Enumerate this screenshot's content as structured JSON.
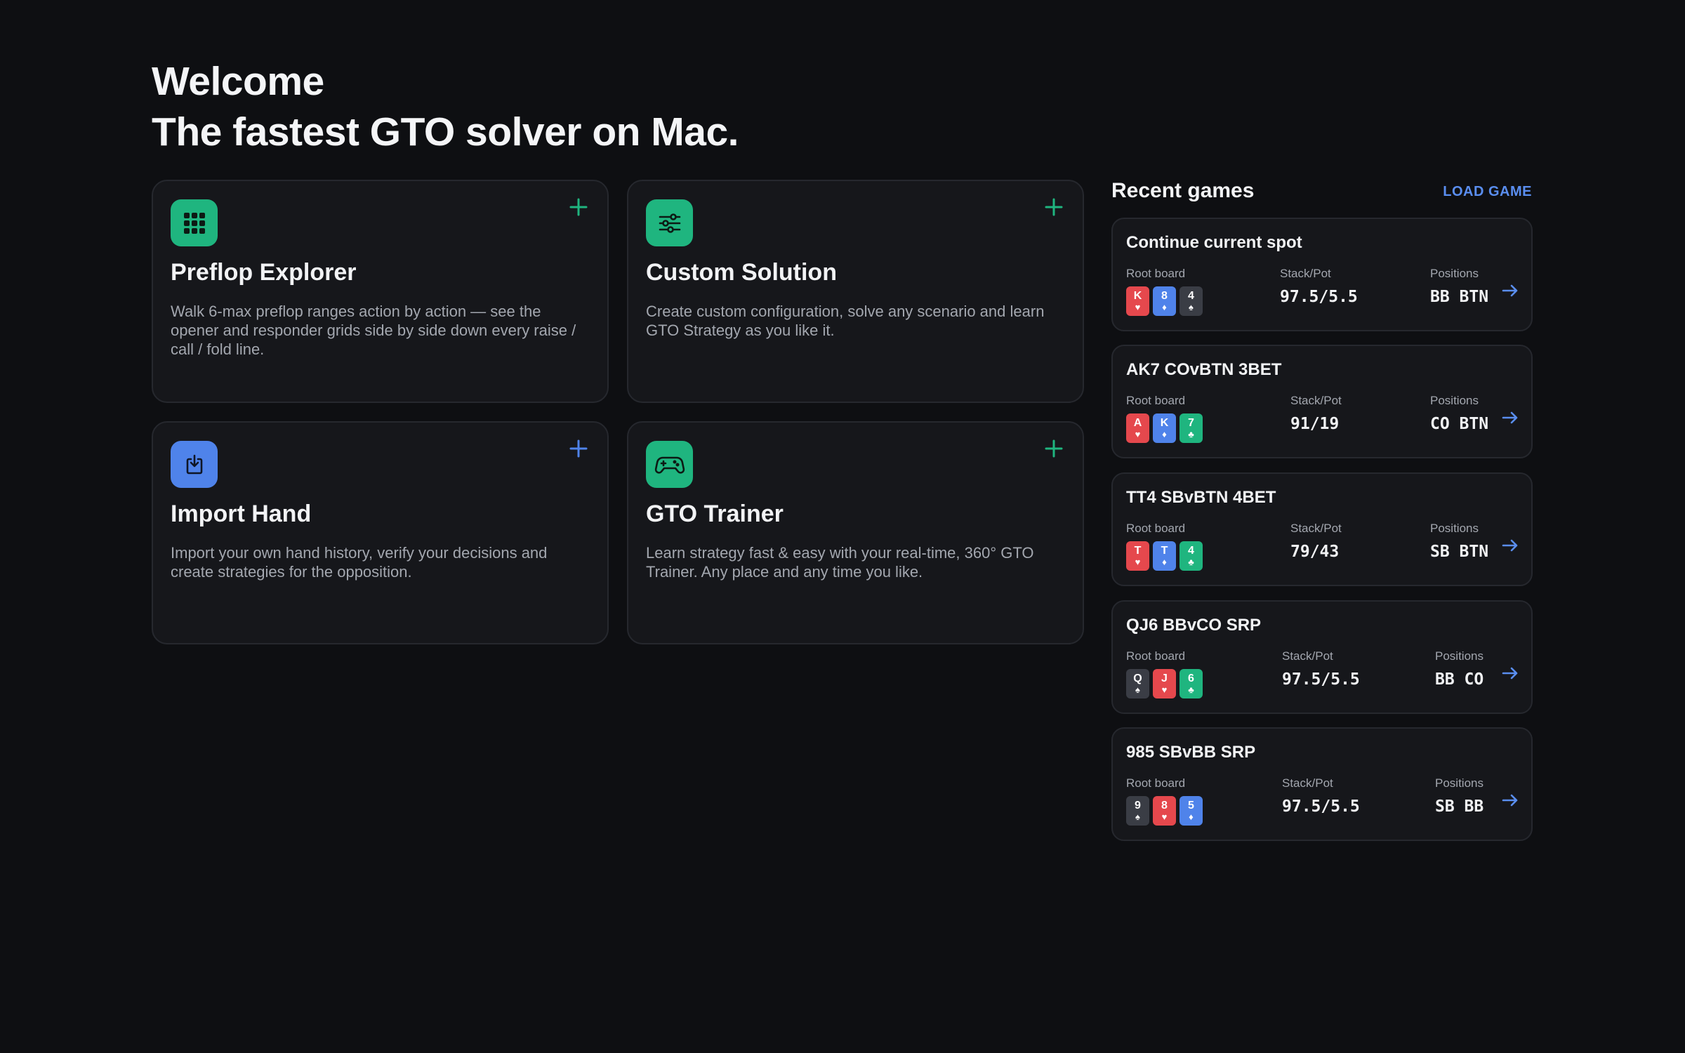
{
  "header": {
    "line1": "Welcome",
    "line2": "The fastest GTO solver on Mac."
  },
  "features": [
    {
      "title": "Preflop Explorer",
      "description": "Walk 6-max preflop ranges action by action — see the opener and responder grids side by side down every raise / call / fold line.",
      "icon": "grid-icon",
      "accent": "#1fb57f"
    },
    {
      "title": "Custom Solution",
      "description": "Create custom configuration, solve any scenario and learn GTO Strategy as you like it.",
      "icon": "sliders-icon",
      "accent": "#1fb57f"
    },
    {
      "title": "Import Hand",
      "description": "Import your own hand history, verify your decisions and create strategies for the opposition.",
      "icon": "import-icon",
      "accent": "#4f83ea"
    },
    {
      "title": "GTO Trainer",
      "description": "Learn strategy fast & easy with your real-time, 360° GTO Trainer. Any place and any time you like.",
      "icon": "gamepad-icon",
      "accent": "#1fb57f"
    }
  ],
  "recent": {
    "title": "Recent games",
    "load_label": "LOAD GAME",
    "labels": {
      "board": "Root board",
      "stack": "Stack/Pot",
      "positions": "Positions"
    },
    "games": [
      {
        "title": "Continue current spot",
        "board": [
          {
            "rank": "K",
            "suit": "♥"
          },
          {
            "rank": "8",
            "suit": "♦"
          },
          {
            "rank": "4",
            "suit": "♠"
          }
        ],
        "stack": "97.5/5.5",
        "positions": "BB BTN"
      },
      {
        "title": "AK7 COvBTN 3BET",
        "board": [
          {
            "rank": "A",
            "suit": "♥"
          },
          {
            "rank": "K",
            "suit": "♦"
          },
          {
            "rank": "7",
            "suit": "♣"
          }
        ],
        "stack": "91/19",
        "positions": "CO BTN"
      },
      {
        "title": "TT4 SBvBTN 4BET",
        "board": [
          {
            "rank": "T",
            "suit": "♥"
          },
          {
            "rank": "T",
            "suit": "♦"
          },
          {
            "rank": "4",
            "suit": "♣"
          }
        ],
        "stack": "79/43",
        "positions": "SB BTN"
      },
      {
        "title": "QJ6 BBvCO SRP",
        "board": [
          {
            "rank": "Q",
            "suit": "♠"
          },
          {
            "rank": "J",
            "suit": "♥"
          },
          {
            "rank": "6",
            "suit": "♣"
          }
        ],
        "stack": "97.5/5.5",
        "positions": "BB CO"
      },
      {
        "title": "985 SBvBB SRP",
        "board": [
          {
            "rank": "9",
            "suit": "♠"
          },
          {
            "rank": "8",
            "suit": "♥"
          },
          {
            "rank": "5",
            "suit": "♦"
          }
        ],
        "stack": "97.5/5.5",
        "positions": "SB BB"
      }
    ]
  },
  "colors": {
    "background": "#0e0f12",
    "card": "#16171b",
    "green": "#1fb57f",
    "blue": "#4f83ea",
    "red": "#e5484d",
    "link": "#5a8ef0"
  }
}
